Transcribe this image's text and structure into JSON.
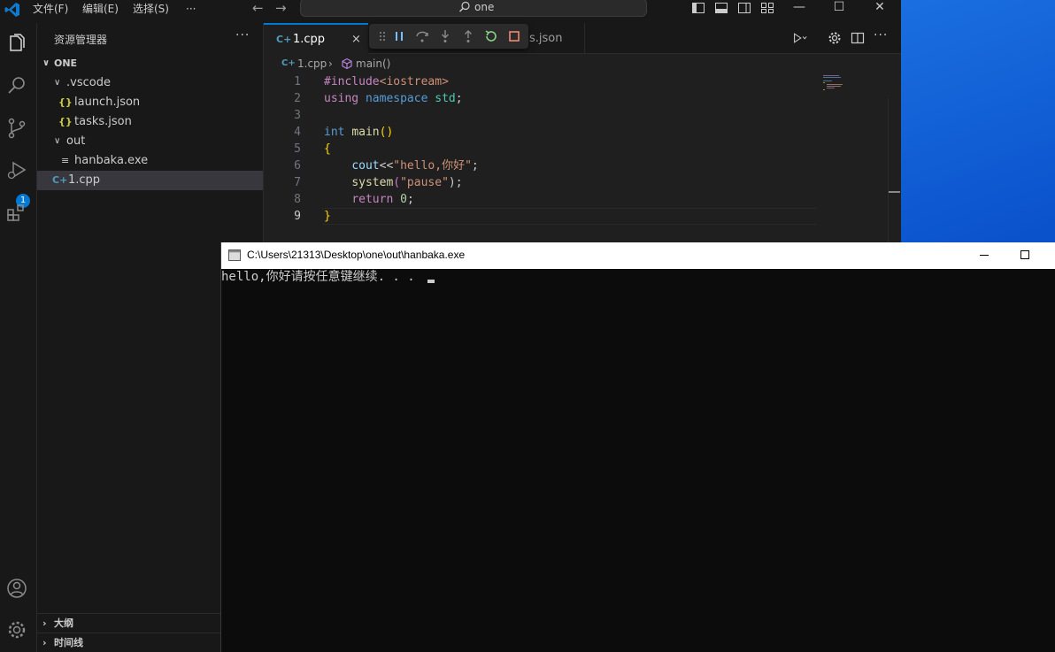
{
  "desktop": {
    "wallpaper_color": "#0a52cc"
  },
  "titlebar": {
    "menu": [
      "文件(F)",
      "编辑(E)",
      "选择(S)",
      "···"
    ],
    "search_text": "one",
    "colors": {
      "bg": "#181818",
      "text": "#cccccc"
    }
  },
  "activity_bar": {
    "items": [
      "explorer-icon",
      "search-icon",
      "source-control-icon",
      "run-debug-icon",
      "extensions-icon"
    ],
    "debug_badge": "1",
    "bottom": [
      "account-icon",
      "manage-gear-icon"
    ]
  },
  "sidebar": {
    "title": "资源管理器",
    "more": "···",
    "root_folder": "ONE",
    "tree": [
      {
        "label": ".vscode",
        "type": "folder"
      },
      {
        "label": "launch.json",
        "type": "json"
      },
      {
        "label": "tasks.json",
        "type": "json"
      },
      {
        "label": "out",
        "type": "folder"
      },
      {
        "label": "hanbaka.exe",
        "type": "file"
      },
      {
        "label": "1.cpp",
        "type": "cpp",
        "selected": true
      }
    ],
    "sections": [
      "大纲",
      "时间线"
    ]
  },
  "editor": {
    "tabs": [
      {
        "label": "1.cpp",
        "active": true
      },
      {
        "label": "s.json",
        "active": false
      }
    ],
    "tab_close": "×",
    "breadcrumb": {
      "file": "1.cpp",
      "symbol": "main()"
    },
    "line_numbers": [
      "1",
      "2",
      "3",
      "4",
      "5",
      "6",
      "7",
      "8",
      "9"
    ],
    "current_line": 9,
    "code": {
      "l1_directive": "#include",
      "l1_header": "<iostream>",
      "l2_using": "using",
      "l2_namespace": "namespace",
      "l2_std": "std",
      "l2_semicolon": ";",
      "l4_int": "int",
      "l4_main": "main",
      "l4_parens": "()",
      "l5_open": "{",
      "l6_cout": "cout",
      "l6_op": "<<",
      "l6_str": "\"hello,你好\"",
      "l6_semi": ";",
      "l7_system": "system",
      "l7_open": "(",
      "l7_str": "\"pause\"",
      "l7_close": ");",
      "l8_return": "return",
      "l8_zero": "0",
      "l8_semi": ";",
      "l9_close": "}"
    }
  },
  "console": {
    "title": "C:\\Users\\21313\\Desktop\\one\\out\\hanbaka.exe",
    "output": "hello,你好请按任意键继续. . . ",
    "colors": {
      "bg": "#0c0c0c",
      "text": "#cccccc",
      "titlebar": "#ffffff"
    }
  }
}
